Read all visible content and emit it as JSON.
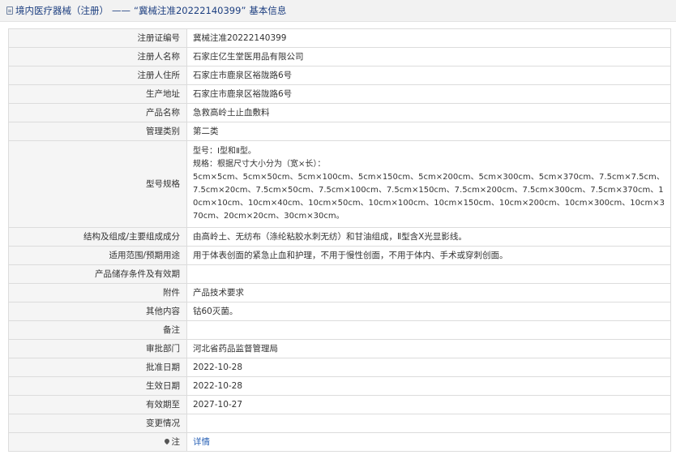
{
  "header": {
    "category": "境内医疗器械（注册）",
    "separator": "——",
    "reg_title": "“冀械注准20222140399”",
    "suffix": "基本信息"
  },
  "rows": {
    "reg_no": {
      "label": "注册证编号",
      "value": "冀械注准20222140399"
    },
    "registrant": {
      "label": "注册人名称",
      "value": "石家庄亿生堂医用品有限公司"
    },
    "registrant_address": {
      "label": "注册人住所",
      "value": "石家庄市鹿泉区裕陇路6号"
    },
    "production_address": {
      "label": "生产地址",
      "value": "石家庄市鹿泉区裕陇路6号"
    },
    "product_name": {
      "label": "产品名称",
      "value": "急救高岭土止血敷料"
    },
    "management_class": {
      "label": "管理类别",
      "value": "第二类"
    },
    "model_spec": {
      "label": "型号规格",
      "line1": "型号：Ⅰ型和Ⅱ型。",
      "line2": "规格：根据尺寸大小分为（宽×长）：",
      "line3": "5cm×5cm、5cm×50cm、5cm×100cm、5cm×150cm、5cm×200cm、5cm×300cm、5cm×370cm、7.5cm×7.5cm、7.5cm×20cm、7.5cm×50cm、7.5cm×100cm、7.5cm×150cm、7.5cm×200cm、7.5cm×300cm、7.5cm×370cm、10cm×10cm、10cm×40cm、10cm×50cm、10cm×100cm、10cm×150cm、10cm×200cm、10cm×300cm、10cm×370cm、20cm×20cm、30cm×30cm。"
    },
    "structure": {
      "label": "结构及组成/主要组成成分",
      "value": "由高岭土、无纺布（涤纶粘胶水刺无纺）和甘油组成，Ⅱ型含X光显影线。"
    },
    "scope": {
      "label": "适用范围/预期用途",
      "value": "用于体表创面的紧急止血和护理，不用于慢性创面，不用于体内、手术或穿刺创面。"
    },
    "storage": {
      "label": "产品储存条件及有效期",
      "value": ""
    },
    "attachment": {
      "label": "附件",
      "value": "产品技术要求"
    },
    "other": {
      "label": "其他内容",
      "value": "钴60灭菌。"
    },
    "remarks": {
      "label": "备注",
      "value": ""
    },
    "approval_dept": {
      "label": "审批部门",
      "value": "河北省药品监督管理局"
    },
    "approval_date": {
      "label": "批准日期",
      "value": "2022-10-28"
    },
    "effective_date": {
      "label": "生效日期",
      "value": "2022-10-28"
    },
    "valid_until": {
      "label": "有效期至",
      "value": "2027-10-27"
    },
    "changes": {
      "label": "变更情况",
      "value": ""
    },
    "note": {
      "label": "注",
      "value": "详情"
    }
  }
}
